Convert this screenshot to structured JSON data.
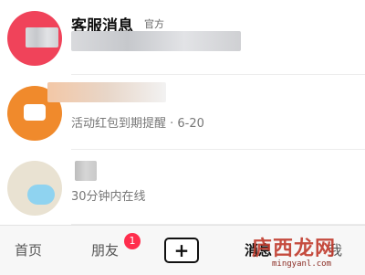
{
  "messages": [
    {
      "title": "客服消息",
      "tag": "官方",
      "preview": "",
      "avatar_color": "#f0435a"
    },
    {
      "title": "",
      "tag": "",
      "preview": "活动红包到期提醒 · 6-20",
      "avatar_color": "#f08a2c"
    },
    {
      "title": "",
      "tag": "",
      "preview": "30分钟内在线",
      "avatar_color": "#e9e2d2"
    }
  ],
  "tabbar": {
    "home": "首页",
    "friends": "朋友",
    "friends_badge": "1",
    "plus": "+",
    "messages": "消息",
    "me": "我"
  },
  "watermark": {
    "text": "庐西龙网",
    "url": "mingyanl.com"
  },
  "colors": {
    "badge": "#ff2e4d",
    "watermark": "#c0392b"
  }
}
